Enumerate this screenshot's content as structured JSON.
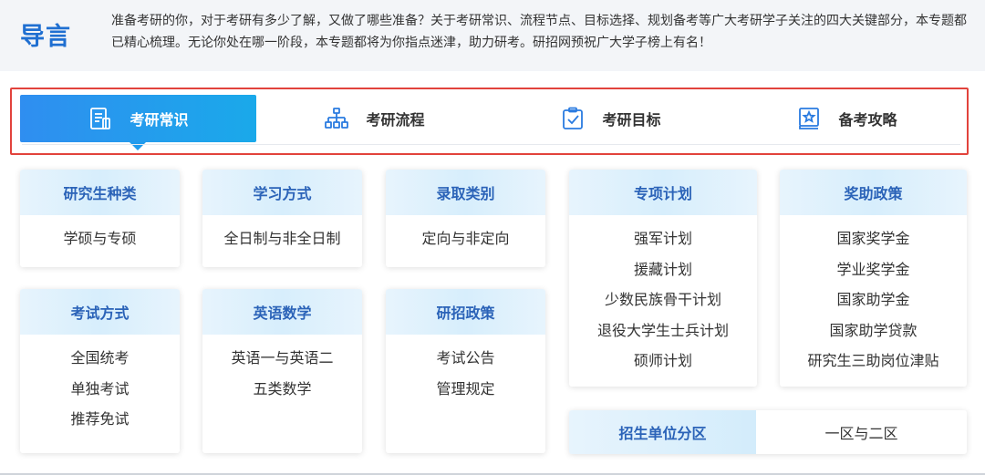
{
  "intro": {
    "title": "导言",
    "text": "准备考研的你，对于考研有多少了解，又做了哪些准备？关于考研常识、流程节点、目标选择、规划备考等广大考研学子关注的四大关键部分，本专题都已精心梳理。无论你处在哪一阶段，本专题都将为你指点迷津，助力研考。研招网预祝广大学子榜上有名！"
  },
  "tabs": [
    {
      "label": "考研常识",
      "icon": "document-list-icon",
      "active": true
    },
    {
      "label": "考研流程",
      "icon": "org-chart-icon",
      "active": false
    },
    {
      "label": "考研目标",
      "icon": "clipboard-check-icon",
      "active": false
    },
    {
      "label": "备考攻略",
      "icon": "star-book-icon",
      "active": false
    }
  ],
  "cards": [
    {
      "title": "研究生种类",
      "items": [
        "学硕与专硕"
      ]
    },
    {
      "title": "学习方式",
      "items": [
        "全日制与非全日制"
      ]
    },
    {
      "title": "录取类别",
      "items": [
        "定向与非定向"
      ]
    },
    {
      "title": "专项计划",
      "items": [
        "强军计划",
        "援藏计划",
        "少数民族骨干计划",
        "退役大学生士兵计划",
        "硕师计划"
      ]
    },
    {
      "title": "奖助政策",
      "items": [
        "国家奖学金",
        "学业奖学金",
        "国家助学金",
        "国家助学贷款",
        "研究生三助岗位津贴"
      ]
    },
    {
      "title": "考试方式",
      "items": [
        "全国统考",
        "单独考试",
        "推荐免试"
      ]
    },
    {
      "title": "英语数学",
      "items": [
        "英语一与英语二",
        "五类数学"
      ]
    },
    {
      "title": "研招政策",
      "items": [
        "考试公告",
        "管理规定"
      ]
    }
  ],
  "wide_card": {
    "title": "招生单位分区",
    "value": "一区与二区"
  },
  "colors": {
    "accent": "#1f6fd1",
    "tab_active_start": "#2f8ef0",
    "tab_active_end": "#1aa9ea",
    "card_title": "#2b63b8",
    "highlight_frame": "#e2433c"
  }
}
